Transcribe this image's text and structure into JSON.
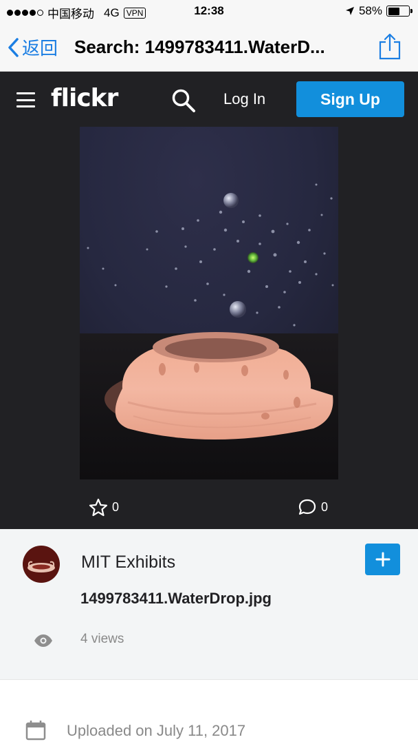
{
  "status_bar": {
    "carrier": "中国移动",
    "network": "4G",
    "vpn": "VPN",
    "time": "12:38",
    "battery": "58%",
    "battery_level": 0.58
  },
  "nav_bar": {
    "back_label": "返回",
    "title": "Search: 1499783411.WaterD..."
  },
  "header": {
    "logo": "flickr",
    "login_label": "Log In",
    "signup_label": "Sign Up"
  },
  "photo": {
    "favorites_count": "0",
    "comments_count": "0"
  },
  "info": {
    "owner_name": "MIT Exhibits",
    "photo_title": "1499783411.WaterDrop.jpg",
    "views": "4 views",
    "uploaded": "Uploaded on July 11, 2017"
  },
  "colors": {
    "accent": "#128fdc",
    "ios_blue": "#1b7ee3",
    "header_bg": "#212124",
    "info_bg": "#f3f5f6"
  }
}
